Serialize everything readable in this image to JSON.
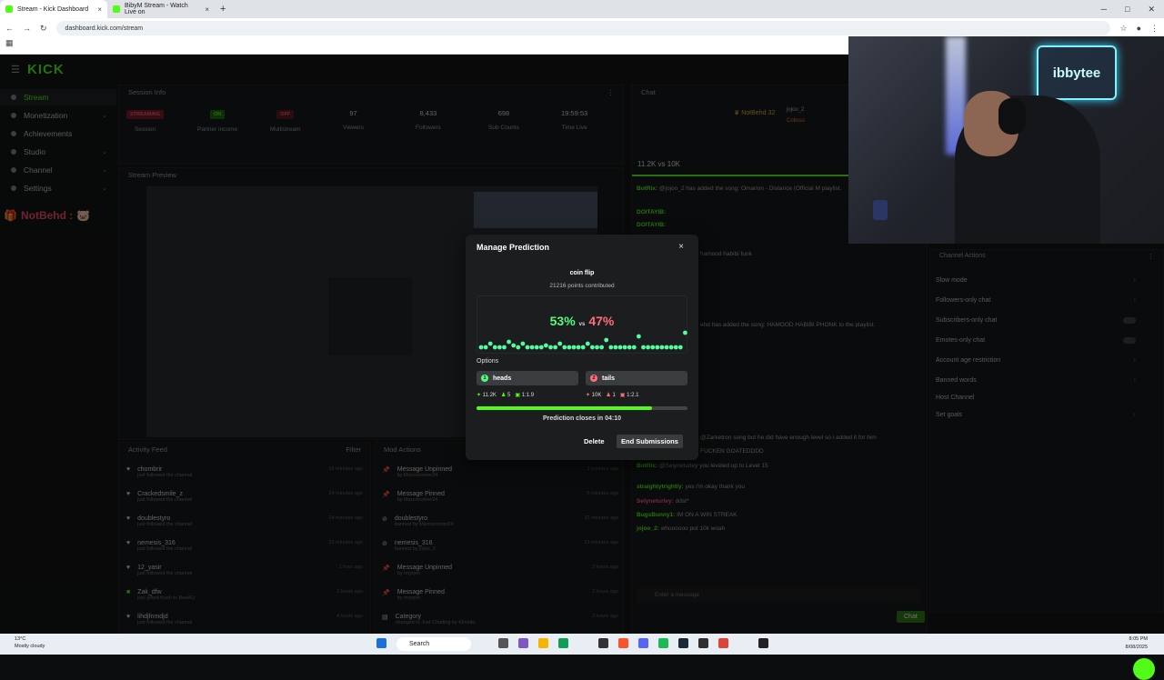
{
  "browser": {
    "tabs": [
      {
        "label": "Stream - Kick Dashboard"
      },
      {
        "label": "BibyM Stream - Watch Live on"
      }
    ],
    "url": "dashboard.kick.com/stream"
  },
  "sidebar": {
    "logo": "KICK",
    "items": [
      {
        "label": "Stream"
      },
      {
        "label": "Monetization"
      },
      {
        "label": "Achievements"
      },
      {
        "label": "Studio"
      },
      {
        "label": "Channel"
      },
      {
        "label": "Settings"
      }
    ],
    "overlay_name": "NotBehd :"
  },
  "session": {
    "title": "Session Info",
    "stats": [
      {
        "value": "STREAMING",
        "label": "Session"
      },
      {
        "value": "ON",
        "label": "Partner income"
      },
      {
        "value": "OFF",
        "label": "Multistream"
      },
      {
        "value": "97",
        "label": "Viewers"
      },
      {
        "value": "8,433",
        "label": "Followers"
      },
      {
        "value": "698",
        "label": "Sub Counts"
      },
      {
        "value": "19:59:53",
        "label": "Time Live"
      }
    ]
  },
  "preview": {
    "title": "Stream Preview"
  },
  "chat": {
    "title": "Chat",
    "top_user": "NotBehd",
    "top_val": "32",
    "user2": "jojoo_2",
    "user3": "Cobsss",
    "pred_summary": "11.2K vs 10K",
    "lines": [
      {
        "user": "BotRix:",
        "text": "@jojoo_2 has added the song: Omarion - Distance (Official M playlist."
      },
      {
        "user": "DOITAYIB:",
        "text": ""
      },
      {
        "user": "DOITAYIB:",
        "text": ""
      },
      {
        "user": "",
        "text": "hamood habibi funk"
      },
      {
        "user": "",
        "text": "ehd has added the song: HAMOOD HABIBI PHONK to the playlist."
      },
      {
        "user": "",
        "text": "@Zarketron song but he did have enough level so i added it for him"
      },
      {
        "user": "",
        "text": "FUCKEN GOATEDDDD"
      },
      {
        "user": "BotRix:",
        "text": "@Selyneturley you leveled up to Level 15"
      },
      {
        "user": "straightytrightly:",
        "text": "yes i'm okay thank you"
      },
      {
        "user": "Selyneturley:",
        "text": "ddst*"
      },
      {
        "user": "BugsBunny1:",
        "text": "IM ON A WIN STREAK"
      },
      {
        "user": "jojoo_2:",
        "text": "whoooooo put 10k woah"
      }
    ],
    "input_placeholder": "Enter a message",
    "send_label": "Chat"
  },
  "channel_actions": {
    "title": "Channel Actions",
    "items": [
      {
        "label": "Slow mode"
      },
      {
        "label": "Followers-only chat"
      },
      {
        "label": "Subscribers-only chat"
      },
      {
        "label": "Emotes-only chat"
      },
      {
        "label": "Account age restriction"
      },
      {
        "label": "Banned words"
      },
      {
        "label": "Host Channel"
      },
      {
        "label": "Set goals"
      }
    ]
  },
  "activity": {
    "title": "Activity Feed",
    "filter": "Filter",
    "rows": [
      {
        "name": "chombrir",
        "sub": "just followed the channel",
        "time": "15 minutes ago"
      },
      {
        "name": "Crackedsmile_z",
        "sub": "just followed the channel",
        "time": "24 minutes ago"
      },
      {
        "name": "doublestyro",
        "sub": "just followed the channel",
        "time": "24 minutes ago"
      },
      {
        "name": "nemesis_316",
        "sub": "just followed the channel",
        "time": "23 minutes ago"
      },
      {
        "name": "12_yasir",
        "sub": "just followed the channel",
        "time": "1 hour ago"
      },
      {
        "name": "Zak_dfw",
        "sub": "just gifted Kush to BenAU",
        "time": "2 hours ago"
      },
      {
        "name": "lihdjfnmdjd",
        "sub": "just followed the channel",
        "time": "4 hours ago"
      }
    ]
  },
  "mod_actions": {
    "title": "Mod Actions",
    "rows": [
      {
        "name": "Message Unpinned",
        "sub": "by Marnocorner24",
        "time": "1 minutes ago"
      },
      {
        "name": "Message Pinned",
        "sub": "by Marnocorner24",
        "time": "5 minutes ago"
      },
      {
        "name": "doublestyro",
        "sub": "banned by Marnocorner24",
        "time": "22 minutes ago"
      },
      {
        "name": "nemesis_316",
        "sub": "banned by jojoo_2",
        "time": "23 minutes ago"
      },
      {
        "name": "Message Unpinned",
        "sub": "by mrjoym",
        "time": "2 hours ago"
      },
      {
        "name": "Message Pinned",
        "sub": "by mrjoym",
        "time": "2 hours ago"
      },
      {
        "name": "Category",
        "sub": "changed to Just Chatting by Klinolla",
        "time": "3 hours ago"
      }
    ]
  },
  "webcam": {
    "neon_text": "ibbytee"
  },
  "modal": {
    "title": "Manage Prediction",
    "close": "×",
    "question": "coin flip",
    "contributed": "21216 points contributed",
    "pct_a": "53%",
    "vs": "vs",
    "pct_b": "47%",
    "options_label": "Options",
    "option_a": {
      "num": "1",
      "label": "heads",
      "points": "11.2K",
      "users": "5",
      "ratio": "1:1.9"
    },
    "option_b": {
      "num": "2",
      "label": "tails",
      "points": "10K",
      "users": "1",
      "ratio": "1:2.1"
    },
    "progress": 0.83,
    "closes": "Prediction closes in 04:10",
    "delete_label": "Delete",
    "end_label": "End Submissions",
    "colors": {
      "a": "#53fc7c",
      "b": "#ff6f7a"
    }
  },
  "taskbar": {
    "temp": "13°C",
    "weather": "Mostly cloudy",
    "search": "Search",
    "time": "8:05 PM",
    "date": "8/08/2025"
  }
}
